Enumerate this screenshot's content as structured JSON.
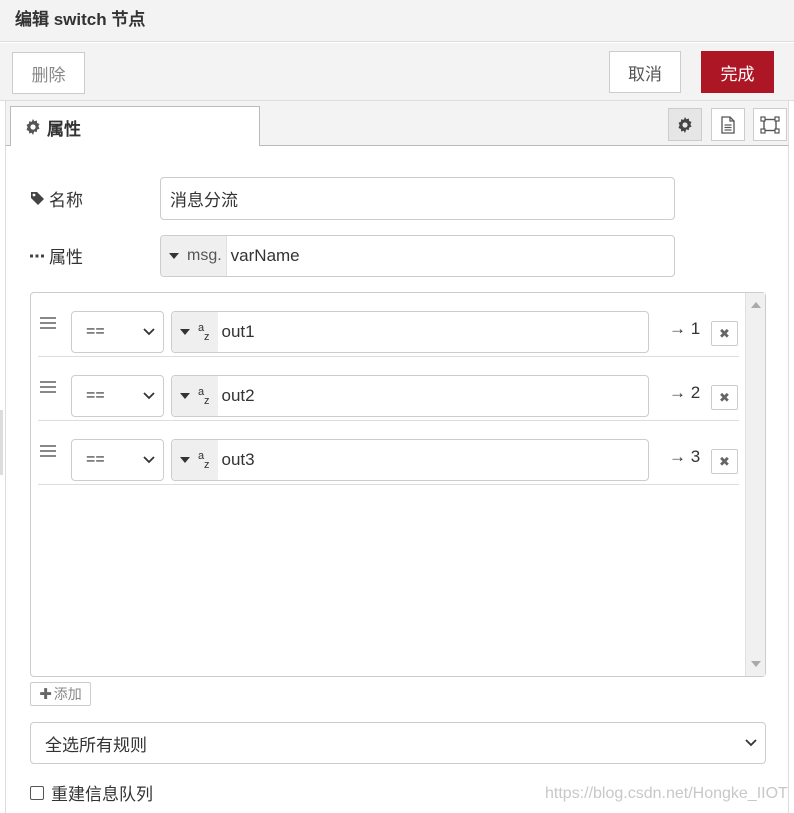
{
  "dialog": {
    "title": "编辑 switch 节点"
  },
  "toolbar": {
    "delete_label": "删除",
    "cancel_label": "取消",
    "done_label": "完成"
  },
  "tabs": {
    "properties_label": "属性"
  },
  "form": {
    "name_label": "名称",
    "name_value": "消息分流",
    "property_label": "属性",
    "property_prefix": "msg.",
    "property_value": "varName"
  },
  "rules": [
    {
      "operator": "==",
      "value": "out1",
      "output": "→ 1"
    },
    {
      "operator": "==",
      "value": "out2",
      "output": "→ 2"
    },
    {
      "operator": "==",
      "value": "out3",
      "output": "→ 3"
    }
  ],
  "type_icon": {
    "top": "a",
    "bottom": "z"
  },
  "add_label": "添加",
  "check_mode": "全选所有规则",
  "recreate_label": "重建信息队列",
  "watermark": "https://blog.csdn.net/Hongke_IIOT",
  "colors": {
    "accent": "#ad1625",
    "panel": "#f3f3f3",
    "border": "#cccccc"
  }
}
